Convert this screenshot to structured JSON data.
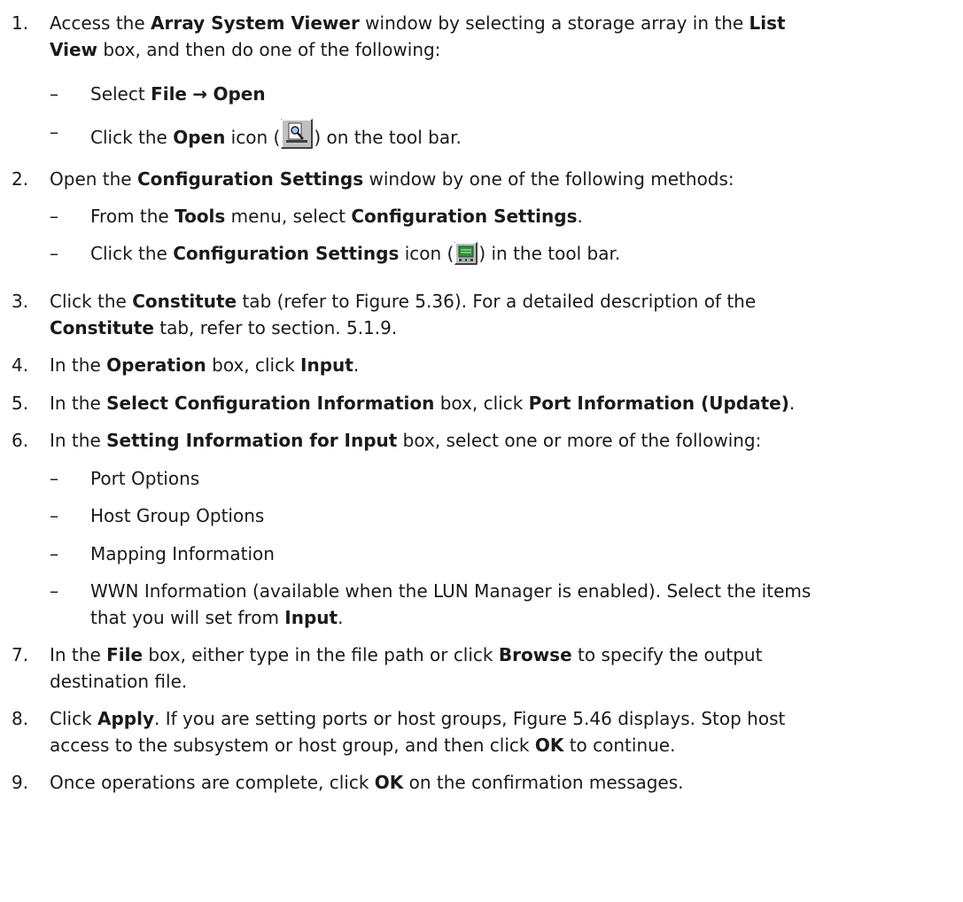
{
  "steps": [
    {
      "number": "1.",
      "line1": {
        "a": "Access the ",
        "b1": "Array System Viewer",
        "c": " window by selecting a storage array in the ",
        "b2": "List"
      },
      "line2": {
        "b": "View",
        "c": " box, and then do one of the following:"
      },
      "subs": [
        {
          "dash": "–",
          "a": "Select ",
          "b1": "File",
          "arrow": "→",
          "b2": "Open"
        },
        {
          "dash": "–",
          "a": "Click the ",
          "b": "Open",
          "c": " icon (",
          "icon": "open-magnifier-icon",
          "d": ") on the tool bar."
        }
      ]
    },
    {
      "number": "2.",
      "a": "Open the ",
      "b": "Configuration Settings",
      "c": " window by one of the following methods:",
      "subs": [
        {
          "dash": "–",
          "a": "From the ",
          "b1": "Tools",
          "c": " menu, select ",
          "b2": "Configuration Settings",
          "d": "."
        },
        {
          "dash": "–",
          "a": "Click the ",
          "b": "Configuration Settings",
          "c": " icon (",
          "icon": "configuration-settings-icon",
          "d": ") in the tool bar."
        }
      ]
    },
    {
      "number": "3.",
      "line1": {
        "a": "Click the ",
        "b": "Constitute",
        "c": " tab (refer to Figure 5.36). For a detailed description of the"
      },
      "line2": {
        "b": "Constitute",
        "c": " tab, refer to section. 5.1.9."
      }
    },
    {
      "number": "4.",
      "a": "In the ",
      "b1": "Operation",
      "c": " box, click ",
      "b2": "Input",
      "d": "."
    },
    {
      "number": "5.",
      "a": "In the ",
      "b1": "Select Configuration Information",
      "c": " box, click ",
      "b2": "Port Information (Update)",
      "d": "."
    },
    {
      "number": "6.",
      "a": "In the ",
      "b": "Setting Information for Input",
      "c": " box, select one or more of the following:",
      "subs": [
        {
          "dash": "–",
          "text": "Port Options"
        },
        {
          "dash": "–",
          "text": "Host Group Options"
        },
        {
          "dash": "–",
          "text": "Mapping Information"
        },
        {
          "dash": "–",
          "line1": "WWN Information (available when the LUN Manager is enabled). Select the items",
          "line2a": "that you will set from ",
          "line2b": "Input",
          "line2c": "."
        }
      ]
    },
    {
      "number": "7.",
      "line1": {
        "a": "In the ",
        "b1": "File",
        "c": " box, either type in the file path or click ",
        "b2": "Browse",
        "d": " to specify the output"
      },
      "line2": {
        "text": "destination file."
      }
    },
    {
      "number": "8.",
      "line1": {
        "a": "Click ",
        "b": "Apply",
        "c": ". If you are setting ports or host groups, Figure 5.46 displays. Stop host"
      },
      "line2": {
        "a": "access to the subsystem or host group, and then click ",
        "b": "OK",
        "c": " to continue."
      }
    },
    {
      "number": "9.",
      "a": "Once operations are complete, click ",
      "b": "OK",
      "c": " on the confirmation messages."
    }
  ]
}
